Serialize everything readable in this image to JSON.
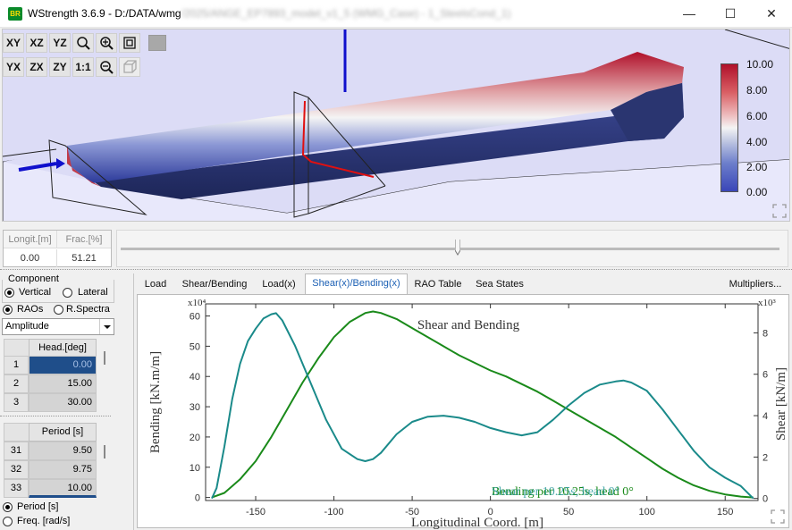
{
  "window": {
    "app_name": "WStrength 3.6.9",
    "path_prefix": " - D:/DATA/wmg",
    "path_blurred": "/2025/ANGE_EP7893_model_v1_5 (WMG_Case) - 1_SteelsCond_1)",
    "logo_text": "BR",
    "controls": {
      "minimize": "—",
      "maximize": "☐",
      "close": "✕"
    }
  },
  "view_toolbar": {
    "row1": [
      "XY",
      "XZ",
      "YZ"
    ],
    "row2": [
      "YX",
      "ZX",
      "ZY",
      "1:1"
    ]
  },
  "colorbar": {
    "ticks": [
      "10.00",
      "8.00",
      "6.00",
      "4.00",
      "2.00",
      "0.00"
    ]
  },
  "position_table": {
    "headers": [
      "Longit.[m]",
      "Frac.[%]"
    ],
    "values": [
      "0.00",
      "51.21"
    ]
  },
  "slider": {
    "value_percent": 51.21
  },
  "component": {
    "label": "Component",
    "options": [
      "Vertical",
      "Lateral"
    ],
    "selected": "Vertical"
  },
  "response_type": {
    "options": [
      "RAOs",
      "R.Spectra"
    ],
    "selected": "RAOs",
    "dropdown_value": "Amplitude"
  },
  "heading_table": {
    "header": "Head.[deg]",
    "rows": [
      {
        "n": "1",
        "v": "0.00"
      },
      {
        "n": "2",
        "v": "15.00"
      },
      {
        "n": "3",
        "v": "30.00"
      }
    ]
  },
  "period_table": {
    "header": "Period [s]",
    "rows": [
      {
        "n": "31",
        "v": "9.50"
      },
      {
        "n": "32",
        "v": "9.75"
      },
      {
        "n": "33",
        "v": "10.00"
      }
    ]
  },
  "x_axis_mode": {
    "options": [
      "Period [s]",
      "Freq. [rad/s]"
    ],
    "selected": "Period [s]"
  },
  "tabs": {
    "items": [
      "Load",
      "Shear/Bending",
      "Load(x)",
      "Shear(x)/Bending(x)",
      "RAO Table",
      "Sea States"
    ],
    "active": "Shear(x)/Bending(x)",
    "multipliers": "Multipliers..."
  },
  "chart_data": {
    "type": "line",
    "title": "Shear and Bending",
    "xlabel": "Longitudinal Coord. [m]",
    "ylabel": "Bending [kN.m/m]",
    "y2label": "Shear [kN/m]",
    "y_exponent": "x10⁴",
    "y2_exponent": "x10³",
    "xlim": [
      -182,
      171
    ],
    "ylim": [
      -1,
      64
    ],
    "y2lim": [
      -0.1,
      9.4
    ],
    "x_ticks": [
      -150,
      -100,
      -50,
      0,
      50,
      100,
      150
    ],
    "y_ticks": [
      0,
      10,
      20,
      30,
      40,
      50,
      60
    ],
    "y2_ticks": [
      0,
      2,
      4,
      6,
      8
    ],
    "series": [
      {
        "name": "Bending per 10.25s, head 0°",
        "axis": "left",
        "color": "#1a8a1a",
        "x": [
          -178,
          -170,
          -160,
          -150,
          -140,
          -130,
          -120,
          -110,
          -100,
          -90,
          -80,
          -75,
          -70,
          -60,
          -50,
          -40,
          -30,
          -20,
          -10,
          0,
          10,
          20,
          30,
          40,
          50,
          60,
          70,
          80,
          90,
          100,
          110,
          120,
          130,
          140,
          150,
          160,
          168
        ],
        "y": [
          0,
          1.5,
          6,
          12,
          20,
          29,
          38,
          46,
          53,
          58,
          61,
          61.5,
          61,
          59,
          56,
          53,
          50,
          47,
          44.5,
          42,
          40,
          37.5,
          35,
          32,
          29,
          26,
          23,
          20,
          16.5,
          13,
          9.5,
          6.5,
          4,
          2.2,
          1,
          0.3,
          0
        ]
      },
      {
        "name": "Shear per 10.25s, head 0°",
        "axis": "right",
        "color": "#1a8a8a",
        "x": [
          -178,
          -175,
          -170,
          -165,
          -160,
          -155,
          -150,
          -145,
          -140,
          -137,
          -133,
          -125,
          -115,
          -105,
          -95,
          -85,
          -80,
          -75,
          -70,
          -60,
          -50,
          -40,
          -30,
          -20,
          -10,
          0,
          10,
          20,
          30,
          40,
          50,
          60,
          70,
          80,
          85,
          90,
          100,
          110,
          120,
          130,
          140,
          150,
          160,
          168
        ],
        "y": [
          0,
          0.5,
          2.5,
          4.8,
          6.5,
          7.6,
          8.2,
          8.7,
          8.9,
          8.95,
          8.6,
          7.4,
          5.6,
          3.8,
          2.4,
          1.9,
          1.8,
          1.9,
          2.2,
          3.1,
          3.7,
          3.95,
          4.0,
          3.9,
          3.7,
          3.4,
          3.2,
          3.05,
          3.2,
          3.8,
          4.5,
          5.1,
          5.5,
          5.65,
          5.7,
          5.6,
          5.2,
          4.3,
          3.3,
          2.3,
          1.5,
          1.0,
          0.6,
          0
        ]
      }
    ]
  }
}
